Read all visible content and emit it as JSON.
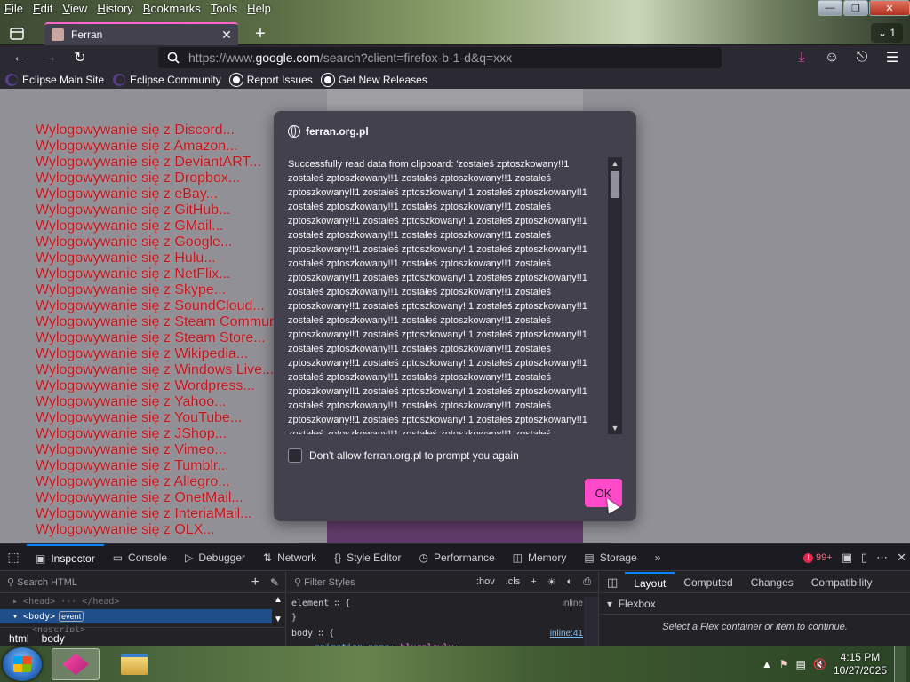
{
  "menubar": {
    "items": [
      {
        "label": "File",
        "accel": "F",
        "rest": "ile"
      },
      {
        "label": "Edit",
        "accel": "E",
        "rest": "dit"
      },
      {
        "label": "View",
        "accel": "V",
        "rest": "iew"
      },
      {
        "label": "History",
        "accel": "H",
        "rest": "istory"
      },
      {
        "label": "Bookmarks",
        "accel": "B",
        "rest": "ookmarks"
      },
      {
        "label": "Tools",
        "accel": "T",
        "rest": "ools"
      },
      {
        "label": "Help",
        "accel": "H",
        "rest": "elp"
      }
    ]
  },
  "tabs": {
    "active_title": "Ferran",
    "count_label": "1"
  },
  "urlbar": {
    "prefix": "https://www.",
    "domain": "google.com",
    "suffix": "/search?client=firefox-b-1-d&q=xxx"
  },
  "bookmarks": [
    {
      "label": "Eclipse Main Site",
      "icon": "eclipse-icon"
    },
    {
      "label": "Eclipse Community",
      "icon": "eclipse-icon"
    },
    {
      "label": "Report Issues",
      "icon": "github-icon"
    },
    {
      "label": "Get New Releases",
      "icon": "github-icon"
    }
  ],
  "page": {
    "logout_links": [
      "Wylogowywanie się z Discord...",
      "Wylogowywanie się z Amazon...",
      "Wylogowywanie się z DeviantART...",
      "Wylogowywanie się z Dropbox...",
      "Wylogowywanie się z eBay...",
      "Wylogowywanie się z GitHub...",
      "Wylogowywanie się z GMail...",
      "Wylogowywanie się z Google...",
      "Wylogowywanie się z Hulu...",
      "Wylogowywanie się z NetFlix...",
      "Wylogowywanie się z Skype...",
      "Wylogowywanie się z SoundCloud...",
      "Wylogowywanie się z Steam Commun",
      "Wylogowywanie się z Steam Store...",
      "Wylogowywanie się z Wikipedia...",
      "Wylogowywanie się z Windows Live...",
      "Wylogowywanie się z Wordpress...",
      "Wylogowywanie się z Yahoo...",
      "Wylogowywanie się z YouTube...",
      "Wylogowywanie się z JShop...",
      "Wylogowywanie się z Vimeo...",
      "Wylogowywanie się z Tumblr...",
      "Wylogowywanie się z Allegro...",
      "Wylogowywanie się z OnetMail...",
      "Wylogowywanie się z InteriaMail...",
      "Wylogowywanie się z OLX..."
    ]
  },
  "modal": {
    "origin": "ferran.org.pl",
    "message_start": "Successfully read data from clipboard: 'zostałeś zptoszkowany!!1",
    "repeat_phrase": "zostałeś zptoszkowany!!1",
    "checkbox_label": "Don't allow ferran.org.pl to prompt you again",
    "checkbox_checked": false,
    "ok_label": "OK",
    "accent_color": "#ff4aca"
  },
  "devtools": {
    "tabs": [
      {
        "label": "Inspector",
        "icon": "inspector-icon",
        "active": true
      },
      {
        "label": "Console",
        "icon": "console-icon",
        "active": false
      },
      {
        "label": "Debugger",
        "icon": "debugger-icon",
        "active": false
      },
      {
        "label": "Network",
        "icon": "network-icon",
        "active": false
      },
      {
        "label": "Style Editor",
        "icon": "style-editor-icon",
        "active": false
      },
      {
        "label": "Performance",
        "icon": "performance-icon",
        "active": false
      },
      {
        "label": "Memory",
        "icon": "memory-icon",
        "active": false
      },
      {
        "label": "Storage",
        "icon": "storage-icon",
        "active": false
      }
    ],
    "error_count": "99+",
    "html_search_placeholder": "Search HTML",
    "tree": {
      "head_line": "<head> ··· </head>",
      "body_line": "<body>",
      "body_badge": "event",
      "next_line": "<noscript>"
    },
    "breadcrumbs": [
      "html",
      "body"
    ],
    "styles_filter_placeholder": "Filter Styles",
    "styles_tools": [
      ":hov",
      ".cls"
    ],
    "rules": [
      {
        "selector": "element",
        "source": "inline",
        "body": "{",
        "close": "}"
      },
      {
        "selector": "body",
        "source": "inline:41",
        "prop": "animation-name",
        "value": "blurslowly;"
      }
    ],
    "layout_tabs": [
      {
        "label": "Layout",
        "active": true
      },
      {
        "label": "Computed",
        "active": false
      },
      {
        "label": "Changes",
        "active": false
      },
      {
        "label": "Compatibility",
        "active": false
      }
    ],
    "flexbox_title": "Flexbox",
    "flexbox_message": "Select a Flex container or item to continue."
  },
  "taskbar": {
    "time": "4:15 PM",
    "date": "10/27/2025"
  }
}
